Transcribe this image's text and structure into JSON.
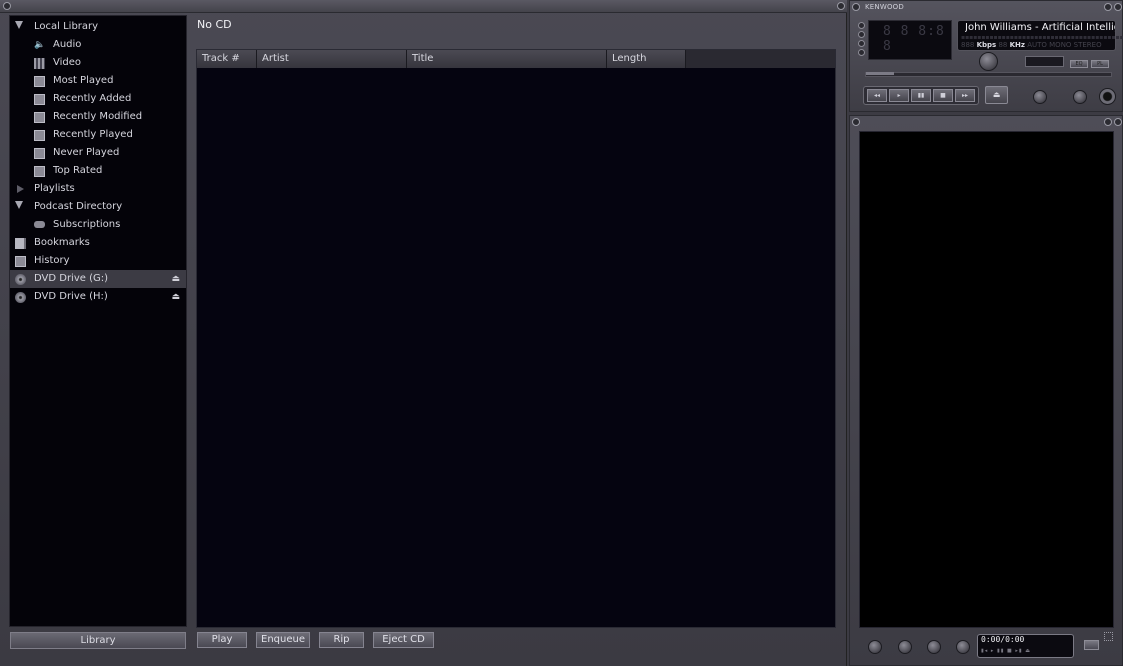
{
  "sidebar": {
    "items": [
      {
        "label": "Local Library",
        "icon": "triangle-down-icon",
        "level": 0
      },
      {
        "label": "Audio",
        "icon": "speaker-icon",
        "level": 1
      },
      {
        "label": "Video",
        "icon": "film-icon",
        "level": 1
      },
      {
        "label": "Most Played",
        "icon": "smart-view-icon",
        "level": 1
      },
      {
        "label": "Recently Added",
        "icon": "smart-view-icon",
        "level": 1
      },
      {
        "label": "Recently Modified",
        "icon": "smart-view-icon",
        "level": 1
      },
      {
        "label": "Recently Played",
        "icon": "smart-view-icon",
        "level": 1
      },
      {
        "label": "Never Played",
        "icon": "smart-view-icon",
        "level": 1
      },
      {
        "label": "Top Rated",
        "icon": "star-view-icon",
        "level": 1
      },
      {
        "label": "Playlists",
        "icon": "triangle-right-icon",
        "level": 0
      },
      {
        "label": "Podcast Directory",
        "icon": "triangle-down-icon",
        "level": 0
      },
      {
        "label": "Subscriptions",
        "icon": "podcast-icon",
        "level": 1
      },
      {
        "label": "Bookmarks",
        "icon": "bookmark-icon",
        "level": 0
      },
      {
        "label": "History",
        "icon": "history-icon",
        "level": 0
      },
      {
        "label": "DVD Drive (G:)",
        "icon": "disc-icon",
        "level": 0,
        "eject": "⏏"
      },
      {
        "label": "DVD Drive (H:)",
        "icon": "disc-icon",
        "level": 0,
        "eject": "⏏"
      }
    ],
    "library_button": "Library"
  },
  "content": {
    "title": "No CD",
    "columns": [
      "Track #",
      "Artist",
      "Title",
      "Length"
    ],
    "buttons": [
      "Play",
      "Enqueue",
      "Rip",
      "Eject CD"
    ]
  },
  "player": {
    "brand": "KENWOOD",
    "time_digits": "8 8 8:8 8",
    "song": "John Williams - Artificial Intellig",
    "kbps_label": "Kbps",
    "khz_label": "KHz",
    "kbps_placeholder": "888",
    "khz_placeholder": "88",
    "mode_labels": "AUTO  MONO  STEREO",
    "eq_label": "EQ",
    "pl_label": "PL",
    "transport": [
      "◂◂",
      "▸",
      "▮▮",
      "■",
      "▸▸"
    ],
    "eject": "⏏"
  },
  "video": {
    "mini_time": "0:00/0:00",
    "mini_controls": "▮◂ ▸ ▮▮ ■ ▸▮ ⏏"
  },
  "colors": {
    "background": "#3c3b43",
    "sidebar_bg": "#040309",
    "selected_row": "#3c3b44",
    "text": "#d6d6de"
  }
}
